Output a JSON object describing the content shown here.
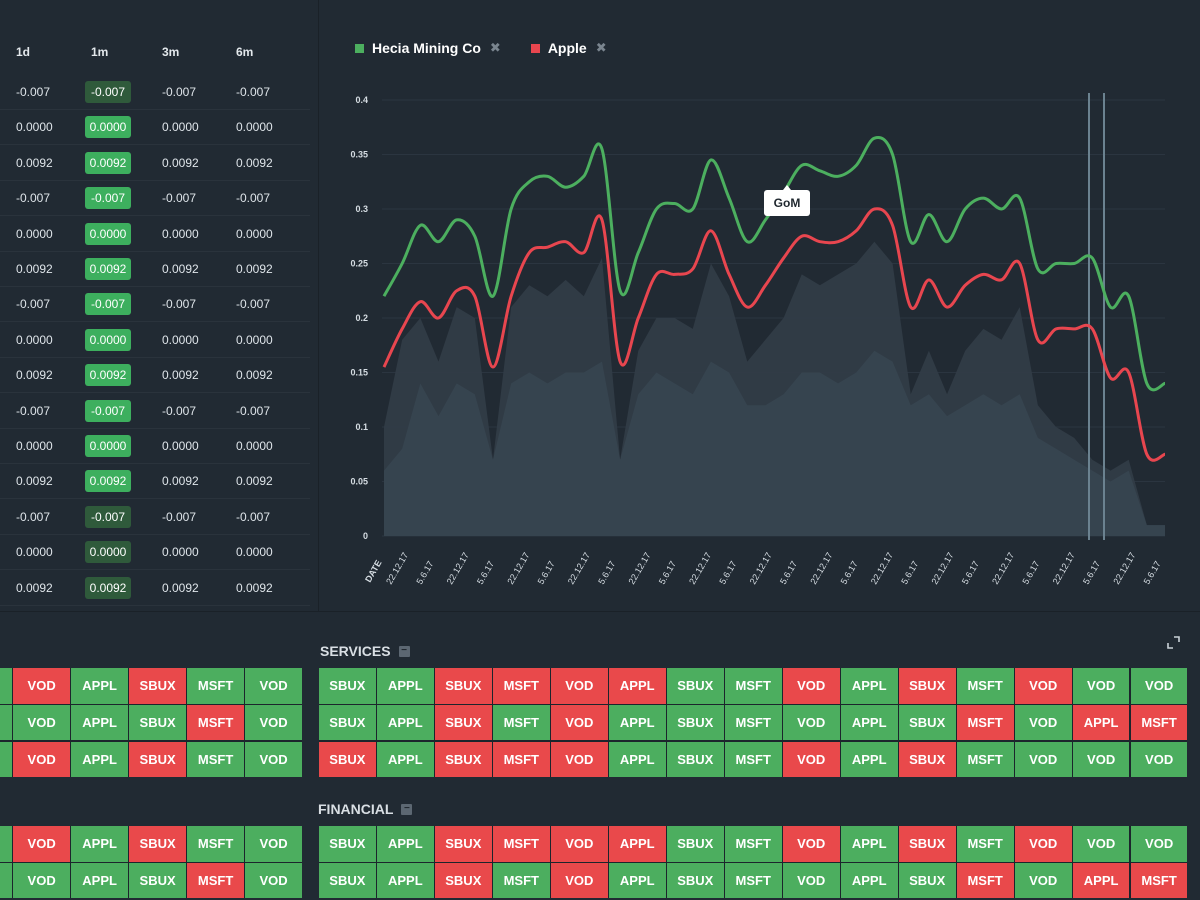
{
  "table": {
    "headers": [
      "1d",
      "1m",
      "3m",
      "6m"
    ],
    "rows": [
      {
        "d1": "-0.007",
        "m1": "-0.007",
        "m3": "-0.007",
        "m6": "-0.007",
        "m1_dark": true
      },
      {
        "d1": "0.0000",
        "m1": "0.0000",
        "m3": "0.0000",
        "m6": "0.0000",
        "m1_dark": false
      },
      {
        "d1": "0.0092",
        "m1": "0.0092",
        "m3": "0.0092",
        "m6": "0.0092",
        "m1_dark": false
      },
      {
        "d1": "-0.007",
        "m1": "-0.007",
        "m3": "-0.007",
        "m6": "-0.007",
        "m1_dark": false
      },
      {
        "d1": "0.0000",
        "m1": "0.0000",
        "m3": "0.0000",
        "m6": "0.0000",
        "m1_dark": false
      },
      {
        "d1": "0.0092",
        "m1": "0.0092",
        "m3": "0.0092",
        "m6": "0.0092",
        "m1_dark": false
      },
      {
        "d1": "-0.007",
        "m1": "-0.007",
        "m3": "-0.007",
        "m6": "-0.007",
        "m1_dark": false
      },
      {
        "d1": "0.0000",
        "m1": "0.0000",
        "m3": "0.0000",
        "m6": "0.0000",
        "m1_dark": false
      },
      {
        "d1": "0.0092",
        "m1": "0.0092",
        "m3": "0.0092",
        "m6": "0.0092",
        "m1_dark": false
      },
      {
        "d1": "-0.007",
        "m1": "-0.007",
        "m3": "-0.007",
        "m6": "-0.007",
        "m1_dark": false
      },
      {
        "d1": "0.0000",
        "m1": "0.0000",
        "m3": "0.0000",
        "m6": "0.0000",
        "m1_dark": false
      },
      {
        "d1": "0.0092",
        "m1": "0.0092",
        "m3": "0.0092",
        "m6": "0.0092",
        "m1_dark": false
      },
      {
        "d1": "-0.007",
        "m1": "-0.007",
        "m3": "-0.007",
        "m6": "-0.007",
        "m1_dark": true
      },
      {
        "d1": "0.0000",
        "m1": "0.0000",
        "m3": "0.0000",
        "m6": "0.0000",
        "m1_dark": true
      },
      {
        "d1": "0.0092",
        "m1": "0.0092",
        "m3": "0.0092",
        "m6": "0.0092",
        "m1_dark": true
      }
    ]
  },
  "chart_data": {
    "type": "line",
    "legend": [
      {
        "name": "Hecia Mining Co",
        "color": "#4caf5f"
      },
      {
        "name": "Apple",
        "color": "#e8464f"
      }
    ],
    "y_ticks": [
      "0",
      "0.05",
      "0.1",
      "0.15",
      "0.2",
      "0.25",
      "0.3",
      "0.35",
      "0.4"
    ],
    "ylim": [
      0,
      0.4
    ],
    "x_axis_label": "DATE",
    "x_ticks": [
      "22.12.17",
      "5.6.17",
      "22.12.17",
      "5.6.17",
      "22.12.17",
      "5.6.17",
      "22.12.17",
      "5.6.17",
      "22.12.17",
      "5.6.17",
      "22.12.17",
      "5.6.17",
      "22.12.17",
      "5.6.17",
      "22.12.17",
      "5.6.17",
      "22.12.17",
      "5.6.17",
      "22.12.17",
      "5.6.17",
      "22.12.17",
      "5.6.17",
      "22.12.17",
      "5.6.17",
      "22.12.17",
      "5.6.17"
    ],
    "tooltip": "GoM",
    "series": [
      {
        "name": "Hecia Mining Co",
        "color": "#4caf5f",
        "values": [
          0.22,
          0.25,
          0.285,
          0.27,
          0.29,
          0.275,
          0.22,
          0.3,
          0.325,
          0.33,
          0.32,
          0.33,
          0.355,
          0.225,
          0.26,
          0.3,
          0.305,
          0.3,
          0.345,
          0.31,
          0.27,
          0.29,
          0.315,
          0.34,
          0.335,
          0.33,
          0.34,
          0.365,
          0.35,
          0.27,
          0.295,
          0.27,
          0.3,
          0.31,
          0.3,
          0.31,
          0.245,
          0.25,
          0.25,
          0.255,
          0.21,
          0.22,
          0.14,
          0.14
        ]
      },
      {
        "name": "Apple",
        "color": "#e8464f",
        "values": [
          0.155,
          0.19,
          0.215,
          0.2,
          0.225,
          0.22,
          0.155,
          0.22,
          0.26,
          0.265,
          0.27,
          0.26,
          0.29,
          0.16,
          0.2,
          0.24,
          0.24,
          0.245,
          0.28,
          0.24,
          0.21,
          0.23,
          0.255,
          0.275,
          0.27,
          0.27,
          0.28,
          0.3,
          0.285,
          0.21,
          0.235,
          0.21,
          0.23,
          0.24,
          0.235,
          0.25,
          0.18,
          0.19,
          0.19,
          0.19,
          0.145,
          0.15,
          0.075,
          0.075
        ]
      },
      {
        "name": "",
        "color": "#313c47",
        "values": [
          0.1,
          0.18,
          0.2,
          0.16,
          0.21,
          0.2,
          0.07,
          0.21,
          0.23,
          0.22,
          0.235,
          0.22,
          0.255,
          0.07,
          0.17,
          0.2,
          0.2,
          0.19,
          0.25,
          0.22,
          0.16,
          0.18,
          0.2,
          0.24,
          0.23,
          0.24,
          0.25,
          0.27,
          0.25,
          0.13,
          0.17,
          0.13,
          0.17,
          0.19,
          0.18,
          0.21,
          0.12,
          0.1,
          0.09,
          0.07,
          0.06,
          0.07,
          0.01,
          0.01
        ]
      },
      {
        "name": "",
        "color": "#374450",
        "values": [
          0.06,
          0.08,
          0.14,
          0.11,
          0.14,
          0.13,
          0.07,
          0.14,
          0.15,
          0.14,
          0.15,
          0.15,
          0.16,
          0.07,
          0.13,
          0.15,
          0.14,
          0.13,
          0.16,
          0.15,
          0.12,
          0.12,
          0.13,
          0.15,
          0.15,
          0.14,
          0.15,
          0.17,
          0.16,
          0.12,
          0.13,
          0.11,
          0.12,
          0.13,
          0.12,
          0.13,
          0.09,
          0.08,
          0.07,
          0.06,
          0.05,
          0.06,
          0.01,
          0.01
        ]
      }
    ]
  },
  "sections": {
    "services_title": "SERVICES",
    "financial_title": "FINANCIAL",
    "collapse_glyph": "−"
  },
  "grids": {
    "left_top": [
      [
        [
          "",
          "up"
        ],
        [
          "VOD",
          "down"
        ],
        [
          "APPL",
          "up"
        ],
        [
          "SBUX",
          "down"
        ],
        [
          "MSFT",
          "up"
        ],
        [
          "VOD",
          "up"
        ]
      ],
      [
        [
          "",
          "up"
        ],
        [
          "VOD",
          "up"
        ],
        [
          "APPL",
          "up"
        ],
        [
          "SBUX",
          "up"
        ],
        [
          "MSFT",
          "down"
        ],
        [
          "VOD",
          "up"
        ]
      ],
      [
        [
          "",
          "up"
        ],
        [
          "VOD",
          "down"
        ],
        [
          "APPL",
          "up"
        ],
        [
          "SBUX",
          "down"
        ],
        [
          "MSFT",
          "up"
        ],
        [
          "VOD",
          "up"
        ]
      ]
    ],
    "left_bottom": [
      [
        [
          "",
          "up"
        ],
        [
          "VOD",
          "down"
        ],
        [
          "APPL",
          "up"
        ],
        [
          "SBUX",
          "down"
        ],
        [
          "MSFT",
          "up"
        ],
        [
          "VOD",
          "up"
        ]
      ],
      [
        [
          "",
          "up"
        ],
        [
          "VOD",
          "up"
        ],
        [
          "APPL",
          "up"
        ],
        [
          "SBUX",
          "up"
        ],
        [
          "MSFT",
          "down"
        ],
        [
          "VOD",
          "up"
        ]
      ]
    ],
    "services": [
      [
        [
          "SBUX",
          "up"
        ],
        [
          "APPL",
          "up"
        ],
        [
          "SBUX",
          "down"
        ],
        [
          "MSFT",
          "down"
        ],
        [
          "VOD",
          "down"
        ],
        [
          "APPL",
          "down"
        ],
        [
          "SBUX",
          "up"
        ],
        [
          "MSFT",
          "up"
        ],
        [
          "VOD",
          "down"
        ],
        [
          "APPL",
          "up"
        ],
        [
          "SBUX",
          "down"
        ],
        [
          "MSFT",
          "up"
        ],
        [
          "VOD",
          "down"
        ],
        [
          "VOD",
          "up"
        ],
        [
          "VOD",
          "up"
        ]
      ],
      [
        [
          "SBUX",
          "up"
        ],
        [
          "APPL",
          "up"
        ],
        [
          "SBUX",
          "down"
        ],
        [
          "MSFT",
          "up"
        ],
        [
          "VOD",
          "down"
        ],
        [
          "APPL",
          "up"
        ],
        [
          "SBUX",
          "up"
        ],
        [
          "MSFT",
          "up"
        ],
        [
          "VOD",
          "up"
        ],
        [
          "APPL",
          "up"
        ],
        [
          "SBUX",
          "up"
        ],
        [
          "MSFT",
          "down"
        ],
        [
          "VOD",
          "up"
        ],
        [
          "APPL",
          "down"
        ],
        [
          "MSFT",
          "down"
        ]
      ],
      [
        [
          "SBUX",
          "down"
        ],
        [
          "APPL",
          "up"
        ],
        [
          "SBUX",
          "down"
        ],
        [
          "MSFT",
          "down"
        ],
        [
          "VOD",
          "down"
        ],
        [
          "APPL",
          "up"
        ],
        [
          "SBUX",
          "up"
        ],
        [
          "MSFT",
          "up"
        ],
        [
          "VOD",
          "down"
        ],
        [
          "APPL",
          "up"
        ],
        [
          "SBUX",
          "down"
        ],
        [
          "MSFT",
          "up"
        ],
        [
          "VOD",
          "up"
        ],
        [
          "VOD",
          "up"
        ],
        [
          "VOD",
          "up"
        ]
      ]
    ],
    "financial": [
      [
        [
          "SBUX",
          "up"
        ],
        [
          "APPL",
          "up"
        ],
        [
          "SBUX",
          "down"
        ],
        [
          "MSFT",
          "down"
        ],
        [
          "VOD",
          "down"
        ],
        [
          "APPL",
          "down"
        ],
        [
          "SBUX",
          "up"
        ],
        [
          "MSFT",
          "up"
        ],
        [
          "VOD",
          "down"
        ],
        [
          "APPL",
          "up"
        ],
        [
          "SBUX",
          "down"
        ],
        [
          "MSFT",
          "up"
        ],
        [
          "VOD",
          "down"
        ],
        [
          "VOD",
          "up"
        ],
        [
          "VOD",
          "up"
        ]
      ],
      [
        [
          "SBUX",
          "up"
        ],
        [
          "APPL",
          "up"
        ],
        [
          "SBUX",
          "down"
        ],
        [
          "MSFT",
          "up"
        ],
        [
          "VOD",
          "down"
        ],
        [
          "APPL",
          "up"
        ],
        [
          "SBUX",
          "up"
        ],
        [
          "MSFT",
          "up"
        ],
        [
          "VOD",
          "up"
        ],
        [
          "APPL",
          "up"
        ],
        [
          "SBUX",
          "up"
        ],
        [
          "MSFT",
          "down"
        ],
        [
          "VOD",
          "up"
        ],
        [
          "APPL",
          "down"
        ],
        [
          "MSFT",
          "down"
        ]
      ]
    ]
  }
}
